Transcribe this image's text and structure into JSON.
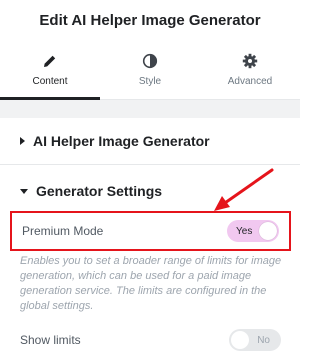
{
  "header": {
    "title": "Edit AI Helper Image Generator"
  },
  "tabs": [
    {
      "label": "Content",
      "icon": "pencil-icon",
      "active": true
    },
    {
      "label": "Style",
      "icon": "half-circle-icon",
      "active": false
    },
    {
      "label": "Advanced",
      "icon": "gear-icon",
      "active": false
    }
  ],
  "sections": {
    "main": {
      "label": "AI Helper Image Generator",
      "expanded": false
    },
    "generator": {
      "label": "Generator Settings",
      "expanded": true
    }
  },
  "controls": {
    "premium_mode": {
      "label": "Premium Mode",
      "toggle_text": "Yes",
      "on": true,
      "description": "Enables you to set a broader range of limits for image generation, which can be used for a paid image generation service. The limits are configured in the global settings."
    },
    "show_limits": {
      "label": "Show limits",
      "toggle_text": "No",
      "on": false
    }
  },
  "colors": {
    "accent_toggle": "#f1c8f0",
    "highlight": "#e5141b",
    "active_tab": "#1f2124"
  }
}
